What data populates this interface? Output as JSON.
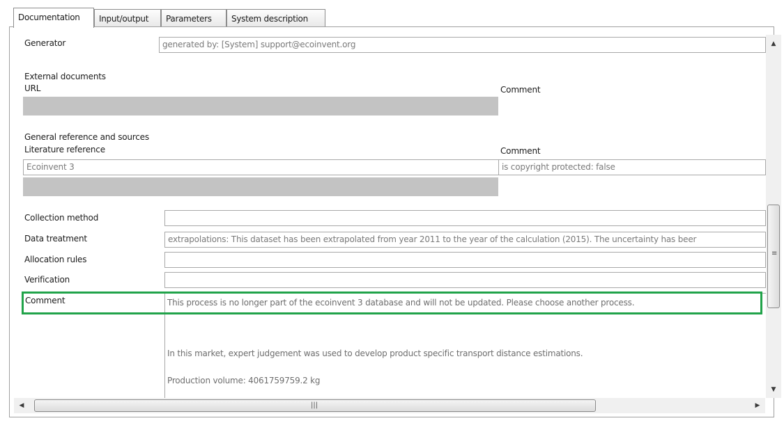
{
  "tabs": [
    "Documentation",
    "Input/output",
    "Parameters",
    "System description"
  ],
  "generator": {
    "label": "Generator",
    "value": "generated by: [System] support@ecoinvent.org"
  },
  "external_documents": {
    "heading": "External documents",
    "url_header": "URL",
    "comment_header": "Comment"
  },
  "general_reference": {
    "heading": "General reference and sources",
    "literature_header": "Literature reference",
    "comment_header": "Comment",
    "literature_value": "Ecoinvent 3",
    "comment_value": "is copyright protected: false"
  },
  "fields": {
    "collection_method": {
      "label": "Collection method",
      "value": ""
    },
    "data_treatment": {
      "label": "Data treatment",
      "value": "extrapolations: This dataset has been extrapolated from year 2011 to the year of the calculation (2015). The uncertainty has beer"
    },
    "allocation_rules": {
      "label": "Allocation rules",
      "value": ""
    },
    "verification": {
      "label": "Verification",
      "value": ""
    },
    "comment": {
      "label": "Comment",
      "line1": "This process is no longer part of the ecoinvent 3 database and will not be updated. Please choose another process.",
      "line2": "In this market, expert judgement was used to develop product specific transport distance estimations.",
      "line3": "Production volume: 4061759759.2 kg"
    }
  },
  "highlight_color": "#21a34a",
  "icons": {
    "scroll_up": "▲",
    "scroll_down": "▼",
    "scroll_left": "◀",
    "scroll_right": "▶",
    "thumb_grip_v": "≡",
    "thumb_grip_h": "|||"
  }
}
